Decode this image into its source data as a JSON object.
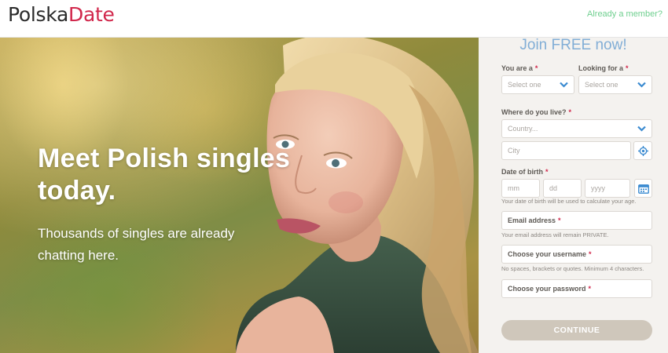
{
  "brand": {
    "logo_part1": "Polska",
    "logo_part2": "Date",
    "logo_dark": "#2b2b2b",
    "logo_accent": "#d1274b"
  },
  "header": {
    "already_member": "Already a member?",
    "link_color": "#6fcf8f"
  },
  "hero": {
    "headline": "Meet Polish singles today.",
    "subheadline": "Thousands of singles are already chatting here."
  },
  "form": {
    "title": "Join FREE now!",
    "title_color": "#82aed6",
    "required_marker": "*",
    "you_are": {
      "label": "You are a",
      "placeholder": "Select one"
    },
    "looking_for": {
      "label": "Looking for a",
      "placeholder": "Select one"
    },
    "where": {
      "label": "Where do you live?",
      "country_placeholder": "Country...",
      "city_placeholder": "City"
    },
    "dob": {
      "label": "Date of birth",
      "mm": "mm",
      "dd": "dd",
      "yyyy": "yyyy",
      "hint": "Your date of birth will be used to calculate your age."
    },
    "email": {
      "label": "Email address",
      "hint": "Your email address will remain PRIVATE."
    },
    "username": {
      "label": "Choose your username",
      "hint": "No spaces, brackets or quotes. Minimum 4 characters."
    },
    "password": {
      "label": "Choose your password"
    },
    "continue_label": "CONTINUE",
    "icons": [
      "chevron-down-icon",
      "location-target-icon",
      "calendar-icon"
    ]
  }
}
